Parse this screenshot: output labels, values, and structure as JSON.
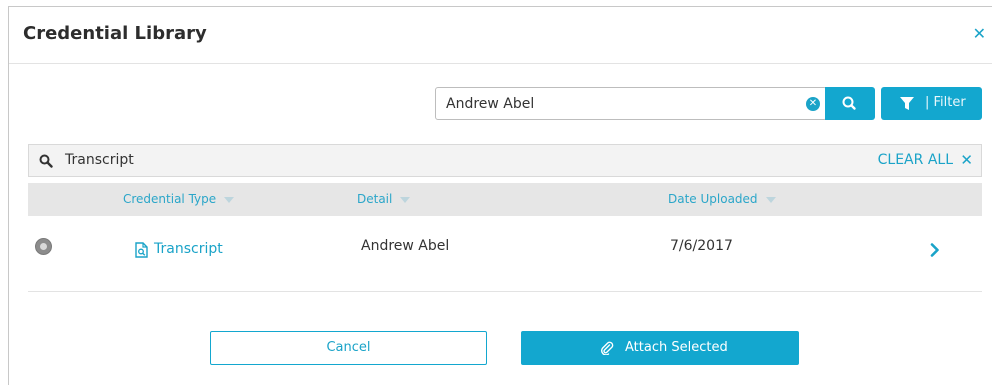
{
  "modal": {
    "title": "Credential Library",
    "close_icon": "close-icon"
  },
  "search": {
    "value": "Andrew Abel",
    "clear_icon": "clear-input-icon",
    "search_icon": "search-icon"
  },
  "filter": {
    "icon": "filter-icon",
    "label": "| Filter"
  },
  "active_filter": {
    "icon": "search-icon",
    "text": "Transcript",
    "clear_all_label": "CLEAR ALL",
    "clear_icon": "close-icon"
  },
  "table": {
    "columns": [
      {
        "label": "Credential Type"
      },
      {
        "label": "Detail"
      },
      {
        "label": "Date Uploaded"
      }
    ],
    "rows": [
      {
        "type": "Transcript",
        "type_icon": "document-search-icon",
        "detail": "Andrew Abel",
        "date": "7/6/2017",
        "action_icon": "chevron-right-icon"
      }
    ]
  },
  "footer": {
    "cancel_label": "Cancel",
    "attach_label": "Attach Selected",
    "attach_icon": "paperclip-icon"
  },
  "colors": {
    "accent": "#13a7cf",
    "link": "#1aa3c8",
    "header_bg": "#e6e6e6"
  }
}
